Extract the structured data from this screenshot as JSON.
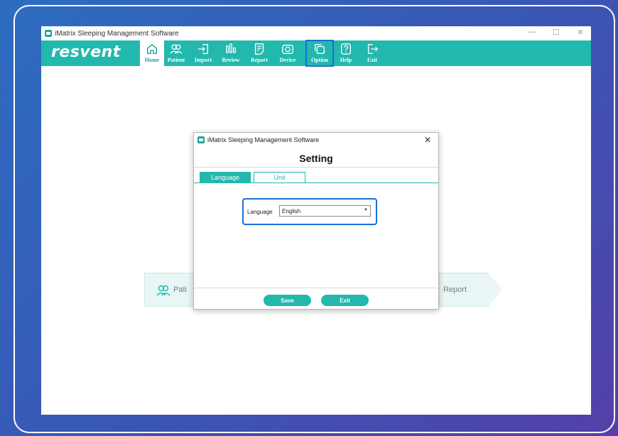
{
  "window": {
    "title": "iMatrix Sleeping Management Software"
  },
  "toolbar": {
    "logo": "resvent",
    "buttons": [
      {
        "label": "Home",
        "icon": "home-icon"
      },
      {
        "label": "Patient",
        "icon": "users-icon"
      },
      {
        "label": "Import",
        "icon": "import-icon"
      },
      {
        "label": "Review",
        "icon": "bars-icon"
      },
      {
        "label": "Report",
        "icon": "document-icon"
      },
      {
        "label": "Device",
        "icon": "device-icon"
      },
      {
        "label": "Option",
        "icon": "copy-icon"
      },
      {
        "label": "Help",
        "icon": "help-icon"
      },
      {
        "label": "Exit",
        "icon": "exit-icon"
      }
    ]
  },
  "workflow": {
    "left_label": "Pati",
    "right_label": "Report"
  },
  "dialog": {
    "title": "iMatrix Sleeping Management Software",
    "heading": "Setting",
    "tabs": [
      "Language",
      "Unit"
    ],
    "language_label": "Language",
    "language_value": "English",
    "save_label": "Save",
    "exit_label": "Exit"
  },
  "colors": {
    "accent": "#22b8ad",
    "highlight": "#1a6fd8"
  }
}
